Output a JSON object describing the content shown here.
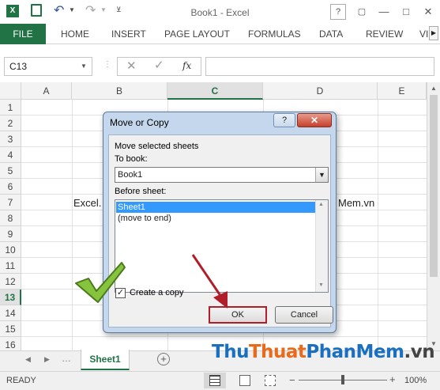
{
  "window": {
    "title": "Book1 - Excel",
    "help_icon": "?",
    "restore_icon": "▢",
    "minimize_icon": "—",
    "maximize_icon": "□",
    "close_icon": "✕"
  },
  "ribbon": {
    "file": "FILE",
    "tabs": [
      "HOME",
      "INSERT",
      "PAGE LAYOUT",
      "FORMULAS",
      "DATA",
      "REVIEW",
      "VI"
    ]
  },
  "formula_bar": {
    "name_box": "C13",
    "fx": "fx",
    "value": ""
  },
  "grid": {
    "columns": [
      "A",
      "B",
      "C",
      "D",
      "E"
    ],
    "rows": [
      "1",
      "2",
      "3",
      "4",
      "5",
      "6",
      "7",
      "8",
      "9",
      "10",
      "11",
      "12",
      "13",
      "14",
      "15",
      "16"
    ],
    "selected_column": "C",
    "selected_row": "13",
    "cell_b7": "Excel.",
    "cell_d7": "Mem.vn"
  },
  "dialog": {
    "title": "Move or Copy",
    "help": "?",
    "close": "✕",
    "move_selected_label": "Move selected sheets",
    "to_book_label": "To book:",
    "to_book_value": "Book1",
    "before_sheet_label": "Before sheet:",
    "sheet_list": [
      "Sheet1",
      "(move to end)"
    ],
    "create_copy_label": "Create a copy",
    "create_copy_checked": true,
    "ok_label": "OK",
    "cancel_label": "Cancel"
  },
  "sheets": {
    "active": "Sheet1",
    "add_icon": "+"
  },
  "status": {
    "text": "READY",
    "zoom": "100%",
    "zoom_minus": "−",
    "zoom_plus": "+"
  },
  "watermark": {
    "part1": "Thu",
    "part2": "Thuat",
    "part3": "PhanMem",
    "part4": ".vn"
  },
  "colors": {
    "excel_green": "#217346",
    "selection_blue": "#3399ff",
    "arrow_red": "#b01e2a",
    "check_green": "#86c43e"
  }
}
